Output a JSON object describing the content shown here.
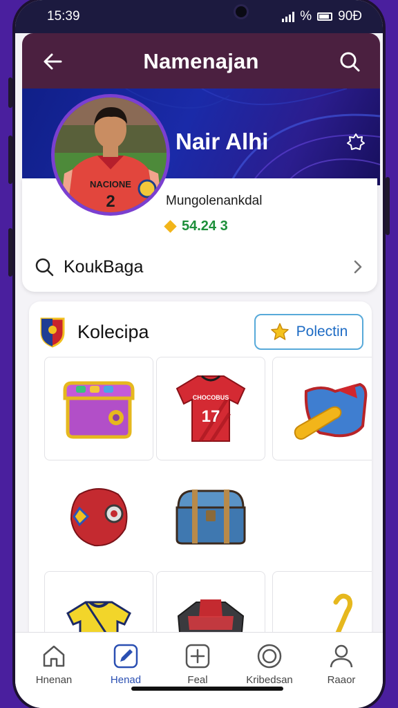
{
  "status_bar": {
    "time": "15:39",
    "network": "%",
    "battery": "90Ð"
  },
  "header": {
    "title": "Namenajan",
    "back_icon": "arrow-left-icon",
    "search_icon": "search-icon"
  },
  "profile": {
    "name": "Nair Alhi",
    "subtitle": "Mungolenankdal",
    "coins": "54.24 3",
    "jersey_text": "NACIONE",
    "jersey_number": "2"
  },
  "search_row": {
    "label": "KoukBaga"
  },
  "collection": {
    "title": "Kolecipa",
    "button_label": "Polectin",
    "items": [
      {
        "name": "treasure-box"
      },
      {
        "name": "red-jersey",
        "text": "CHOCOBUS",
        "number": "17"
      },
      {
        "name": "sneaker"
      },
      {
        "name": "red-ball"
      },
      {
        "name": "blue-chest"
      },
      {
        "name": "empty"
      },
      {
        "name": "yellow-jersey"
      },
      {
        "name": "red-jacket"
      },
      {
        "name": "whistle"
      }
    ]
  },
  "bottom_nav": [
    {
      "label": "Hnenan",
      "icon": "home-icon"
    },
    {
      "label": "Henad",
      "icon": "edit-icon",
      "active": true
    },
    {
      "label": "Feal",
      "icon": "add-icon"
    },
    {
      "label": "Kribedsan",
      "icon": "target-icon"
    },
    {
      "label": "Raaor",
      "icon": "profile-icon"
    }
  ],
  "colors": {
    "header": "#4b2040",
    "banner": "#1a2aa8",
    "accent": "#2a4fb2",
    "coin": "#1d8f3a",
    "frame": "#4a1f9e"
  }
}
